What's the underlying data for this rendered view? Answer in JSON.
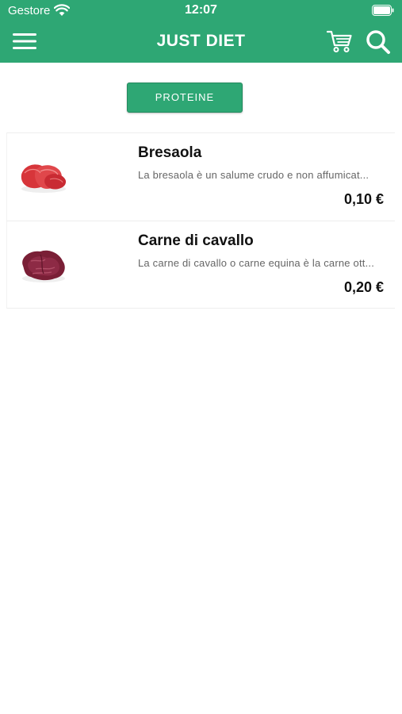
{
  "status_bar": {
    "carrier": "Gestore",
    "time": "12:07"
  },
  "nav": {
    "title": "JUST DIET"
  },
  "category": {
    "label": "PROTEINE"
  },
  "products": [
    {
      "name": "Bresaola",
      "description": "La bresaola è un salume crudo e non affumicat...",
      "price": "0,10 €",
      "image_icon": "bresaola-image"
    },
    {
      "name": "Carne di cavallo",
      "description": "La carne di cavallo o carne equina è la carne ott...",
      "price": "0,20 €",
      "image_icon": "horse-meat-image"
    }
  ],
  "colors": {
    "brand": "#2ea774",
    "text": "#111111",
    "muted": "#666666",
    "background": "#ffffff"
  }
}
